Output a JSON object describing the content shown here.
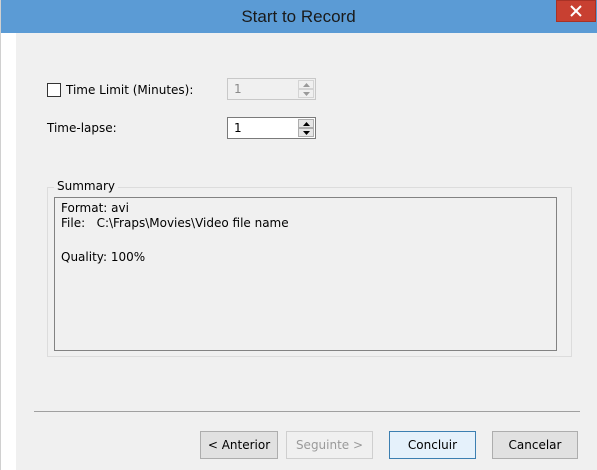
{
  "window": {
    "title": "Start to Record"
  },
  "time_limit": {
    "label": "Time Limit (Minutes):",
    "checked": false,
    "value": "1",
    "enabled": false
  },
  "time_lapse": {
    "label": "Time-lapse:",
    "value": "1"
  },
  "summary": {
    "legend": "Summary",
    "format_line": "Format: avi",
    "file_line": "File:   C:\\Fraps\\Movies\\Video file name",
    "quality_line": "Quality: 100%"
  },
  "buttons": {
    "back": "< Anterior",
    "next": "Seguinte >",
    "finish": "Concluir",
    "cancel": "Cancelar"
  },
  "colors": {
    "titlebar": "#5b9bd5",
    "close_button": "#c84031",
    "panel": "#f0f0f0"
  },
  "icons": {
    "close": "close-icon",
    "spin_up": "arrow-up-icon",
    "spin_down": "arrow-down-icon"
  }
}
